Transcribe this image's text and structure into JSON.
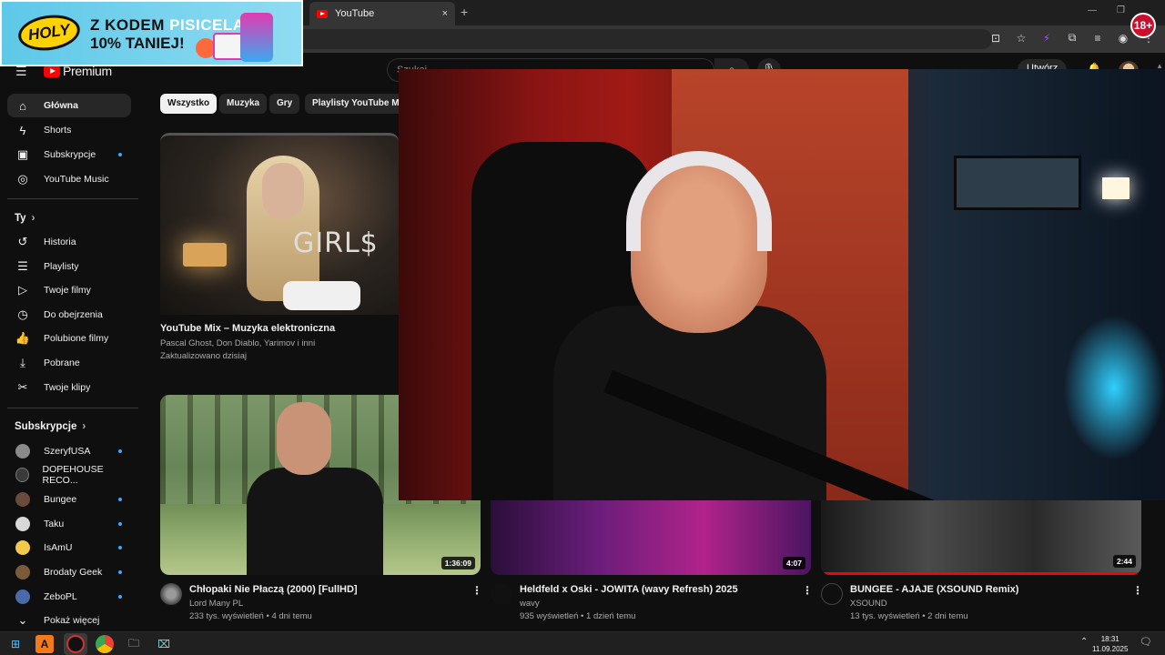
{
  "browser": {
    "tab_title": "YouTube",
    "tab_close": "×",
    "new_tab": "+"
  },
  "ad": {
    "brand": "HOLY",
    "line1_prefix": "Z KODEM ",
    "line1_code": "PISICELA",
    "line2": "10% TANIEJ!",
    "age_badge": "18+"
  },
  "youtube": {
    "logo_text": "Premium",
    "search_placeholder": "Szukaj",
    "create_label": "Utwórz"
  },
  "sidebar": {
    "main": [
      {
        "label": "Główna",
        "icon": "home-icon"
      },
      {
        "label": "Shorts",
        "icon": "shorts-icon"
      },
      {
        "label": "Subskrypcje",
        "icon": "subscriptions-icon"
      },
      {
        "label": "YouTube Music",
        "icon": "music-icon"
      }
    ],
    "you_heading": "Ty",
    "you": [
      {
        "label": "Historia",
        "icon": "history-icon"
      },
      {
        "label": "Playlisty",
        "icon": "playlists-icon"
      },
      {
        "label": "Twoje filmy",
        "icon": "your-videos-icon"
      },
      {
        "label": "Do obejrzenia",
        "icon": "watch-later-icon"
      },
      {
        "label": "Polubione filmy",
        "icon": "liked-icon"
      },
      {
        "label": "Pobrane",
        "icon": "download-icon"
      },
      {
        "label": "Twoje klipy",
        "icon": "clips-icon"
      }
    ],
    "subs_heading": "Subskrypcje",
    "subs": [
      {
        "label": "SzeryfUSA",
        "color": "#8a8a8a"
      },
      {
        "label": "DOPEHOUSE RECO...",
        "color": "#3a3a3a"
      },
      {
        "label": "Bungee",
        "color": "#6a4a3a"
      },
      {
        "label": "Taku",
        "color": "#d8d8d8"
      },
      {
        "label": "IsAmU",
        "color": "#f2c94c"
      },
      {
        "label": "Brodaty Geek",
        "color": "#7a5a3a"
      },
      {
        "label": "ZeboPL",
        "color": "#4a6aaa"
      }
    ],
    "show_more": "Pokaż więcej"
  },
  "chips": [
    "Wszystko",
    "Muzyka",
    "Gry",
    "Playlisty YouTube Mix"
  ],
  "mix": {
    "thumb_text": "GIRL$",
    "title": "YouTube Mix – Muzyka elektroniczna",
    "artists": "Pascal Ghost, Don Diablo, Yarimov i inni",
    "updated": "Zaktualizowano dzisiaj"
  },
  "videos": [
    {
      "title": "Chłopaki Nie Płaczą (2000) [FullHD]",
      "channel": "Lord Many PL",
      "meta": "233 tys. wyświetleń • 4 dni temu",
      "duration": "1:36:09"
    },
    {
      "title": "Heldfeld x Oski - JOWITA (wavy Refresh) 2025",
      "channel": "wavy",
      "meta": "935 wyświetleń • 1 dzień temu",
      "duration": "4:07"
    },
    {
      "title": "BUNGEE - AJAJE (XSOUND Remix)",
      "channel": "XSOUND",
      "meta": "13 tys. wyświetleń • 2 dni temu",
      "duration": "2:44"
    }
  ],
  "taskbar": {
    "time": "18:31",
    "date": "11.09.2025"
  }
}
